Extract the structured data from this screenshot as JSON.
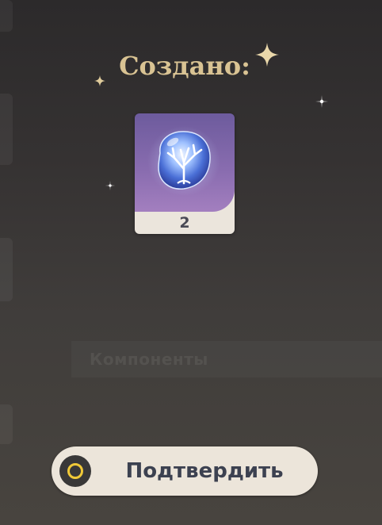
{
  "result": {
    "title": "Создано:"
  },
  "item": {
    "quantity": "2",
    "icon": "crystal-orb-tree-icon",
    "rarity_color": "#8a6db0"
  },
  "background": {
    "section_label": "Компоненты"
  },
  "actions": {
    "confirm_label": "Подтвердить",
    "confirm_icon": "gamepad-a-button-icon",
    "accent": "#f0c938"
  }
}
